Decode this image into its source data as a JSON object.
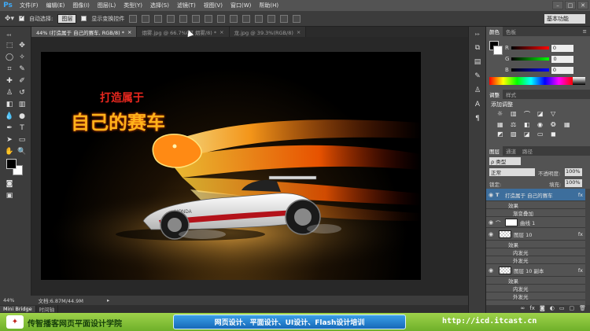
{
  "menubar": {
    "logo": "Ps",
    "items": [
      "文件(F)",
      "编辑(E)",
      "图像(I)",
      "图层(L)",
      "类型(Y)",
      "选择(S)",
      "滤镜(T)",
      "视图(V)",
      "窗口(W)",
      "帮助(H)"
    ]
  },
  "optionsbar": {
    "auto_select_label": "自动选择:",
    "auto_select_value": "图层",
    "show_transform_label": "显示变换控件",
    "workspace": "基本功能"
  },
  "tabs": [
    {
      "label": "44% (打造属于 自己的赛车, RGB/8) *"
    },
    {
      "label": "烟雾.jpg @ 66.7%(灯 烟雾/8) *"
    },
    {
      "label": "龙.jpg @ 39.3%(RGB/8)"
    }
  ],
  "artwork": {
    "headline_top": "打造属于",
    "headline_main": "自己的赛车",
    "car_brand": "HONDA"
  },
  "status": {
    "zoom": "44%",
    "doc_size": "文档:6.87M/44.9M"
  },
  "bridge_tabs": [
    "Mini Bridge",
    "时间轴"
  ],
  "color_panel": {
    "tabs": [
      "颜色",
      "色板"
    ],
    "r_label": "R",
    "g_label": "G",
    "b_label": "B",
    "r": "0",
    "g": "0",
    "b": "0"
  },
  "adjust_panel": {
    "tabs": [
      "调整",
      "样式"
    ],
    "title": "添加调整"
  },
  "layers_panel": {
    "tabs": [
      "图层",
      "通道",
      "路径"
    ],
    "kind_filter": "ρ 类型",
    "blend_mode": "正常",
    "opacity_label": "不透明度:",
    "opacity": "100%",
    "lock_label": "锁定:",
    "fill_label": "填充:",
    "fill": "100%",
    "layers": [
      {
        "name": "打造属于 自己的赛车",
        "kind": "text",
        "fx": "fx"
      },
      {
        "name": "效果",
        "kind": "effect"
      },
      {
        "name": "渐变叠加",
        "kind": "effect-item"
      },
      {
        "name": "曲线 1",
        "kind": "adjustment"
      },
      {
        "name": "图层 10",
        "kind": "pixel",
        "fx": "fx"
      },
      {
        "name": "效果",
        "kind": "effect"
      },
      {
        "name": "内发光",
        "kind": "effect-item"
      },
      {
        "name": "外发光",
        "kind": "effect-item"
      },
      {
        "name": "图层 10 副本",
        "kind": "pixel",
        "fx": "fx"
      },
      {
        "name": "效果",
        "kind": "effect"
      },
      {
        "name": "内发光",
        "kind": "effect-item"
      },
      {
        "name": "外发光",
        "kind": "effect-item"
      }
    ]
  },
  "banner": {
    "left": "传智播客网页平面设计学院",
    "center": "网页设计、平面设计、UI设计、Flash设计培训",
    "right": "http://icd.itcast.cn"
  },
  "colors": {
    "accent": "#3fa9f5",
    "canvas": "#282828",
    "panel": "#535353",
    "banner_green": "#8dc63f",
    "banner_blue": "#1e7bd0"
  }
}
